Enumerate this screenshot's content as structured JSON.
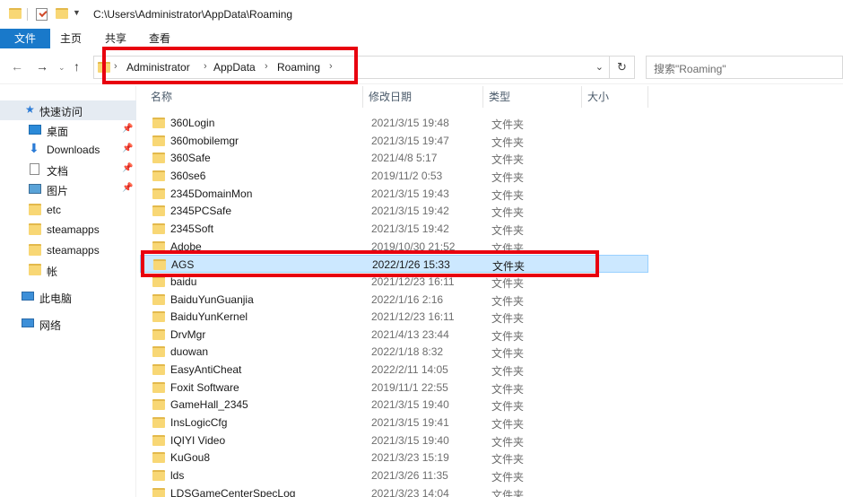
{
  "window": {
    "path_title": "C:\\Users\\Administrator\\AppData\\Roaming"
  },
  "ribbon": {
    "tabs": [
      "文件",
      "主页",
      "共享",
      "查看"
    ]
  },
  "address": {
    "crumbs": [
      "Administrator",
      "AppData",
      "Roaming"
    ],
    "search_placeholder": "搜索\"Roaming\""
  },
  "sidebar": {
    "items": [
      {
        "label": "快速访问",
        "icon": "star-icon"
      },
      {
        "label": "桌面",
        "icon": "desktop-icon",
        "pinned": true
      },
      {
        "label": "Downloads",
        "icon": "download-icon",
        "pinned": true
      },
      {
        "label": "文档",
        "icon": "document-icon",
        "pinned": true
      },
      {
        "label": "图片",
        "icon": "picture-icon",
        "pinned": true
      },
      {
        "label": "etc",
        "icon": "folder-icon"
      },
      {
        "label": "steamapps",
        "icon": "folder-icon"
      },
      {
        "label": "steamapps",
        "icon": "folder-icon"
      },
      {
        "label": "帐",
        "icon": "folder-icon"
      },
      {
        "label": "此电脑",
        "icon": "computer-icon"
      },
      {
        "label": "网络",
        "icon": "network-icon"
      }
    ]
  },
  "columns": {
    "name": "名称",
    "date": "修改日期",
    "type": "类型",
    "size": "大小"
  },
  "files": [
    {
      "name": "360Login",
      "date": "2021/3/15 19:48",
      "type": "文件夹"
    },
    {
      "name": "360mobilemgr",
      "date": "2021/3/15 19:47",
      "type": "文件夹"
    },
    {
      "name": "360Safe",
      "date": "2021/4/8 5:17",
      "type": "文件夹"
    },
    {
      "name": "360se6",
      "date": "2019/11/2 0:53",
      "type": "文件夹"
    },
    {
      "name": "2345DomainMon",
      "date": "2021/3/15 19:43",
      "type": "文件夹"
    },
    {
      "name": "2345PCSafe",
      "date": "2021/3/15 19:42",
      "type": "文件夹"
    },
    {
      "name": "2345Soft",
      "date": "2021/3/15 19:42",
      "type": "文件夹"
    },
    {
      "name": "Adobe",
      "date": "2019/10/30 21:52",
      "type": "文件夹"
    },
    {
      "name": "AGS",
      "date": "2022/1/26 15:33",
      "type": "文件夹",
      "selected": true
    },
    {
      "name": "baidu",
      "date": "2021/12/23 16:11",
      "type": "文件夹"
    },
    {
      "name": "BaiduYunGuanjia",
      "date": "2022/1/16 2:16",
      "type": "文件夹"
    },
    {
      "name": "BaiduYunKernel",
      "date": "2021/12/23 16:11",
      "type": "文件夹"
    },
    {
      "name": "DrvMgr",
      "date": "2021/4/13 23:44",
      "type": "文件夹"
    },
    {
      "name": "duowan",
      "date": "2022/1/18 8:32",
      "type": "文件夹"
    },
    {
      "name": "EasyAntiCheat",
      "date": "2022/2/11 14:05",
      "type": "文件夹"
    },
    {
      "name": "Foxit Software",
      "date": "2019/11/1 22:55",
      "type": "文件夹"
    },
    {
      "name": "GameHall_2345",
      "date": "2021/3/15 19:40",
      "type": "文件夹"
    },
    {
      "name": "InsLogicCfg",
      "date": "2021/3/15 19:41",
      "type": "文件夹"
    },
    {
      "name": "IQIYI Video",
      "date": "2021/3/15 19:40",
      "type": "文件夹"
    },
    {
      "name": "KuGou8",
      "date": "2021/3/23 15:19",
      "type": "文件夹"
    },
    {
      "name": "lds",
      "date": "2021/3/26 11:35",
      "type": "文件夹"
    },
    {
      "name": "LDSGameCenterSpecLog",
      "date": "2021/3/23 14:04",
      "type": "文件夹"
    }
  ],
  "colors": {
    "accent": "#1979ca",
    "highlight": "#e8000f",
    "selection": "#cce8ff",
    "folder": "#f8d775"
  }
}
